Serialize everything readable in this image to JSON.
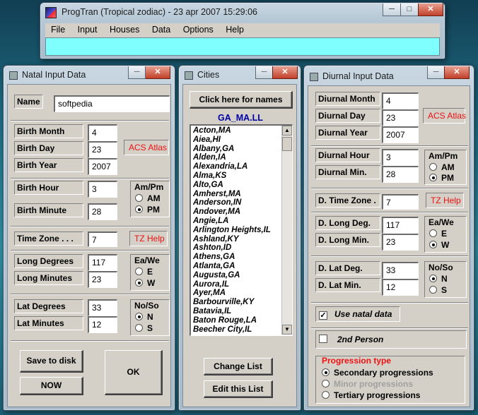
{
  "main_window": {
    "title": "ProgTran (Tropical zodiac) - 23 apr 2007     15:29:06",
    "menu": [
      "File",
      "Input",
      "Houses",
      "Data",
      "Options",
      "Help"
    ],
    "accent": "#80ffff"
  },
  "natal": {
    "title": "Natal Input Data",
    "name_label": "Name",
    "name_value": "softpedia",
    "birth_month_label": "Birth Month",
    "birth_month": "4",
    "birth_day_label": "Birth Day",
    "birth_day": "23",
    "birth_year_label": "Birth Year",
    "birth_year": "2007",
    "acs_atlas": "ACS Atlas",
    "birth_hour_label": "Birth Hour",
    "birth_hour": "3",
    "birth_minute_label": "Birth Minute",
    "birth_minute": "28",
    "ampm": {
      "title": "Am/Pm",
      "options": [
        "AM",
        "PM"
      ],
      "selected": "PM"
    },
    "timezone_label": "Time Zone . . .",
    "timezone": "7",
    "tz_help": "TZ Help",
    "long_deg_label": "Long Degrees",
    "long_deg": "117",
    "long_min_label": "Long Minutes",
    "long_min": "23",
    "eawe": {
      "title": "Ea/We",
      "options": [
        "E",
        "W"
      ],
      "selected": "W"
    },
    "lat_deg_label": "Lat Degrees",
    "lat_deg": "33",
    "lat_min_label": "Lat Minutes",
    "lat_min": "12",
    "noso": {
      "title": "No/So",
      "options": [
        "N",
        "S"
      ],
      "selected": "N"
    },
    "save_button": "Save to disk",
    "ok_button": "OK",
    "now_button": "NOW"
  },
  "cities": {
    "title": "Cities",
    "names_button": "Click here for names",
    "file_label": "GA_MA.LL",
    "list": [
      "Acton,MA",
      "Aiea,HI",
      "Albany,GA",
      "Alden,IA",
      "Alexandria,LA",
      "Alma,KS",
      "Alto,GA",
      "Amherst,MA",
      "Anderson,IN",
      "Andover,MA",
      "Angie,LA",
      "Arlington Heights,IL",
      "Ashland,KY",
      "Ashton,ID",
      "Athens,GA",
      "Atlanta,GA",
      "Augusta,GA",
      "Aurora,IL",
      "Ayer,MA",
      "Barbourville,KY",
      "Batavia,IL",
      "Baton Rouge,LA",
      "Beecher City,IL"
    ],
    "change_button": "Change List",
    "edit_button": "Edit this List"
  },
  "diurnal": {
    "title": "Diurnal Input Data",
    "month_label": "Diurnal Month",
    "month": "4",
    "day_label": "Diurnal Day",
    "day": "23",
    "year_label": "Diurnal Year",
    "year": "2007",
    "acs_atlas": "ACS Atlas",
    "hour_label": "Diurnal Hour",
    "hour": "3",
    "min_label": "Diurnal Min.",
    "min": "28",
    "ampm": {
      "title": "Am/Pm",
      "options": [
        "AM",
        "PM"
      ],
      "selected": "PM"
    },
    "tz_label": "D. Time Zone .",
    "tz": "7",
    "tz_help": "TZ Help",
    "long_deg_label": "D. Long Deg.",
    "long_deg": "117",
    "long_min_label": "D. Long Min.",
    "long_min": "23",
    "eawe": {
      "title": "Ea/We",
      "options": [
        "E",
        "W"
      ],
      "selected": "W"
    },
    "lat_deg_label": "D. Lat Deg.",
    "lat_deg": "33",
    "lat_min_label": "D. Lat Min.",
    "lat_min": "12",
    "noso": {
      "title": "No/So",
      "options": [
        "N",
        "S"
      ],
      "selected": "N"
    },
    "use_natal_label": "Use natal data",
    "use_natal_checked": true,
    "second_person_label": "2nd Person",
    "second_person_checked": false,
    "progression": {
      "title": "Progression type",
      "options": [
        "Secondary progressions",
        "Minor progressions",
        "Tertiary progressions"
      ],
      "selected": "Secondary progressions",
      "disabled": "Minor progressions"
    }
  }
}
